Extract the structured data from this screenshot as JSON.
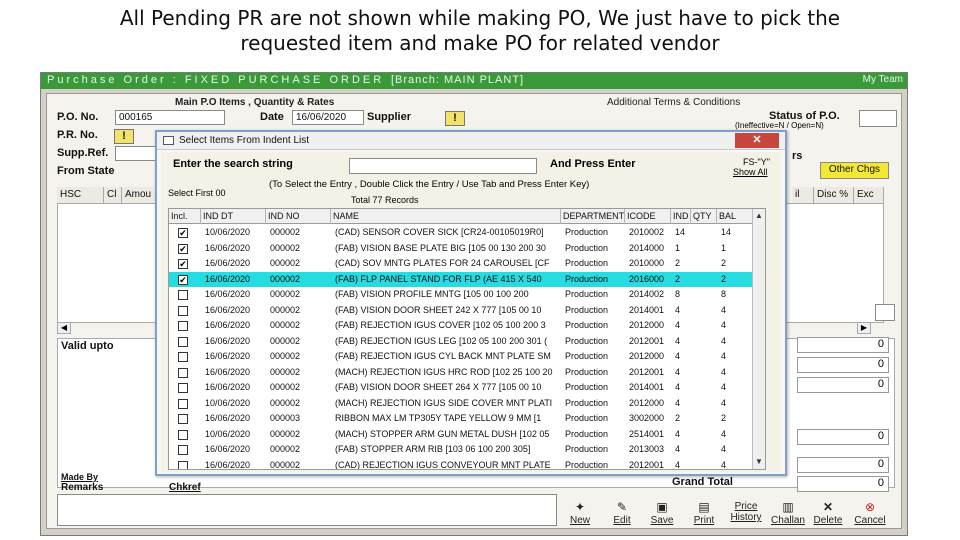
{
  "slide": {
    "title_line1": "All Pending PR are not shown while making PO, We just have to pick the",
    "title_line2": "requested item and make PO for related vendor"
  },
  "window": {
    "title": "Purchase Order : FIXED PURCHASE ORDER",
    "branch": "[Branch: MAIN PLANT]",
    "right_text": "My Team",
    "accent_color": "#3a9a3a"
  },
  "tabs": {
    "main": "Main P.O Items , Quantity & Rates",
    "additional": "Additional Terms & Conditions"
  },
  "form": {
    "po_no_label": "P.O. No.",
    "po_no_value": "000165",
    "date_label": "Date",
    "date_value": "16/06/2020",
    "supplier_label": "Supplier",
    "pr_no_label": "P.R. No.",
    "supp_ref_label": "Supp.Ref.",
    "from_state_label": "From State",
    "status_label": "Status of P.O.",
    "status_value": "(Ineffective=N / Open=N)",
    "rs_label": "rs",
    "fs_label": "FS-\"Y\"",
    "show_all_label": "Show All",
    "other_chgs_label": "Other Chgs",
    "warn_symbol": "!"
  },
  "grid_headers": {
    "hsc": "HSC",
    "cl": "Cl",
    "amount": "Amou",
    "il": "il",
    "disc": "Disc %",
    "exc": "Exc"
  },
  "lower": {
    "valid_upto": "Valid upto",
    "made_by": "Made By",
    "remarks": "Remarks",
    "chkref": "Chkref",
    "grand_total": "Grand Total",
    "right_values": [
      "0",
      "0",
      "0",
      "0",
      "0",
      "0"
    ]
  },
  "toolbar": [
    {
      "label": "New",
      "icon": "new-icon"
    },
    {
      "label": "Edit",
      "icon": "edit-icon"
    },
    {
      "label": "Save",
      "icon": "save-icon"
    },
    {
      "label": "Print",
      "icon": "print-icon"
    },
    {
      "label": "Price History",
      "icon": "price-history-icon"
    },
    {
      "label": "Challan",
      "icon": "challan-icon"
    },
    {
      "label": "Delete",
      "icon": "delete-icon"
    },
    {
      "label": "Cancel",
      "icon": "cancel-icon"
    }
  ],
  "dialog": {
    "title": "Select Items From Indent List",
    "close": "✕",
    "search_label": "Enter the search string",
    "press_enter": "And Press Enter",
    "instruction": "(To Select the Entry , Double Click the Entry / Use Tab and Press Enter Key)",
    "select_first": "Select First 00",
    "total": "Total 77 Records",
    "columns": [
      "Incl.",
      "IND DT",
      "IND NO",
      "NAME",
      "DEPARTMENT",
      "ICODE",
      "IND",
      "QTY",
      "BAL"
    ],
    "selected_color": "#26dce0",
    "rows": [
      {
        "checked": true,
        "dt": "10/06/2020",
        "no": "000002",
        "name": "(CAD) SENSOR COVER SICK [CR24-00105019R0]",
        "dept": "Production",
        "icode": "2010002",
        "ind": "14",
        "qty": "",
        "bal": "14",
        "selected": false
      },
      {
        "checked": true,
        "dt": "16/06/2020",
        "no": "000002",
        "name": "(FAB) VISION BASE PLATE BIG [105 00 130 200 30",
        "dept": "Production",
        "icode": "2014000",
        "ind": "1",
        "qty": "",
        "bal": "1",
        "selected": false
      },
      {
        "checked": true,
        "dt": "16/06/2020",
        "no": "000002",
        "name": "(CAD) SOV MNTG PLATES FOR 24 CAROUSEL [CF",
        "dept": "Production",
        "icode": "2010000",
        "ind": "2",
        "qty": "",
        "bal": "2",
        "selected": false
      },
      {
        "checked": true,
        "dt": "16/06/2020",
        "no": "000002",
        "name": "(FAB) FLP PANEL STAND FOR FLP (AE 415 X 540",
        "dept": "Production",
        "icode": "2016000",
        "ind": "2",
        "qty": "",
        "bal": "2",
        "selected": true
      },
      {
        "checked": false,
        "dt": "16/06/2020",
        "no": "000002",
        "name": "(FAB) VISION PROFILE MNTG [105 00 100 200",
        "dept": "Production",
        "icode": "2014002",
        "ind": "8",
        "qty": "",
        "bal": "8",
        "selected": false
      },
      {
        "checked": false,
        "dt": "16/06/2020",
        "no": "000002",
        "name": "(FAB) VISION DOOR SHEET 242 X 777 [105 00 10",
        "dept": "Production",
        "icode": "2014001",
        "ind": "4",
        "qty": "",
        "bal": "4",
        "selected": false
      },
      {
        "checked": false,
        "dt": "16/06/2020",
        "no": "000002",
        "name": "(FAB) REJECTION IGUS COVER [102 05 100 200 3",
        "dept": "Production",
        "icode": "2012000",
        "ind": "4",
        "qty": "",
        "bal": "4",
        "selected": false
      },
      {
        "checked": false,
        "dt": "16/06/2020",
        "no": "000002",
        "name": "(FAB) REJECTION IGUS LEG [102 05 100 200 301 (",
        "dept": "Production",
        "icode": "2012001",
        "ind": "4",
        "qty": "",
        "bal": "4",
        "selected": false
      },
      {
        "checked": false,
        "dt": "16/06/2020",
        "no": "000002",
        "name": "(FAB) REJECTION IGUS CYL BACK MNT PLATE SM",
        "dept": "Production",
        "icode": "2012000",
        "ind": "4",
        "qty": "",
        "bal": "4",
        "selected": false
      },
      {
        "checked": false,
        "dt": "16/06/2020",
        "no": "000002",
        "name": "(MACH) REJECTION IGUS HRC ROD [102 25 100 20",
        "dept": "Production",
        "icode": "2012001",
        "ind": "4",
        "qty": "",
        "bal": "4",
        "selected": false
      },
      {
        "checked": false,
        "dt": "16/06/2020",
        "no": "000002",
        "name": "(FAB) VISION DOOR SHEET 264 X 777 [105 00 10",
        "dept": "Production",
        "icode": "2014001",
        "ind": "4",
        "qty": "",
        "bal": "4",
        "selected": false
      },
      {
        "checked": false,
        "dt": "10/06/2020",
        "no": "000002",
        "name": "(MACH) REJECTION IGUS SIDE COVER MNT PLATI",
        "dept": "Production",
        "icode": "2012000",
        "ind": "4",
        "qty": "",
        "bal": "4",
        "selected": false
      },
      {
        "checked": false,
        "dt": "16/06/2020",
        "no": "000003",
        "name": "RIBBON MAX LM TP305Y TAPE YELLOW 9 MM [1",
        "dept": "Production",
        "icode": "3002000",
        "ind": "2",
        "qty": "",
        "bal": "2",
        "selected": false
      },
      {
        "checked": false,
        "dt": "10/06/2020",
        "no": "000002",
        "name": "(MACH) STOPPER ARM GUN METAL DUSH [102 05",
        "dept": "Production",
        "icode": "2514001",
        "ind": "4",
        "qty": "",
        "bal": "4",
        "selected": false
      },
      {
        "checked": false,
        "dt": "16/06/2020",
        "no": "000002",
        "name": "(FAB) STOPPER ARM RIB [103 06 100 200 305]",
        "dept": "Production",
        "icode": "2013003",
        "ind": "4",
        "qty": "",
        "bal": "4",
        "selected": false
      },
      {
        "checked": false,
        "dt": "16/06/2020",
        "no": "000002",
        "name": "(CAD) REJECTION IGUS CONVEYOUR MNT PLATE",
        "dept": "Production",
        "icode": "2012001",
        "ind": "4",
        "qty": "",
        "bal": "4",
        "selected": false
      }
    ]
  }
}
